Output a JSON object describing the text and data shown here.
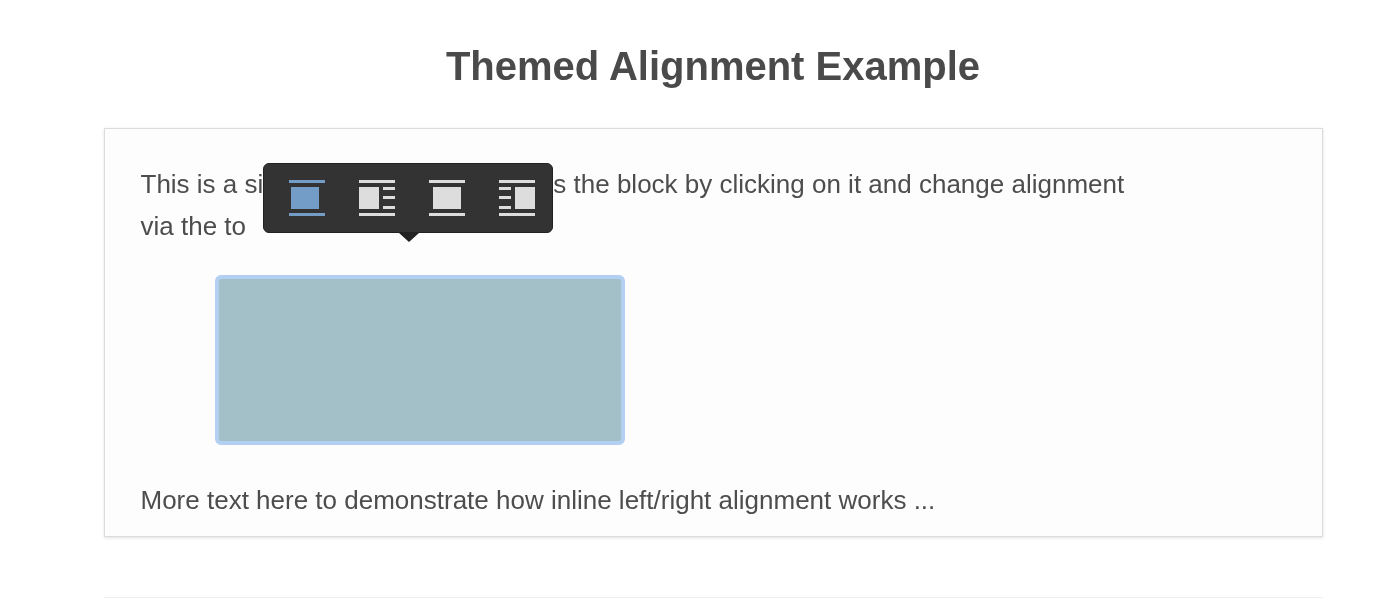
{
  "title": "Themed Alignment Example",
  "paragraph_lines": [
    "This is a si",
    "s the block by clicking on it and change alignment",
    "via the to"
  ],
  "toolbar": {
    "buttons": [
      {
        "kind": "wide",
        "selected": true
      },
      {
        "kind": "left",
        "selected": false
      },
      {
        "kind": "center",
        "selected": false
      },
      {
        "kind": "right",
        "selected": false
      }
    ]
  },
  "block": {
    "focused": true
  },
  "footer_text": "More text here to demonstrate how inline left/right alignment works ..."
}
